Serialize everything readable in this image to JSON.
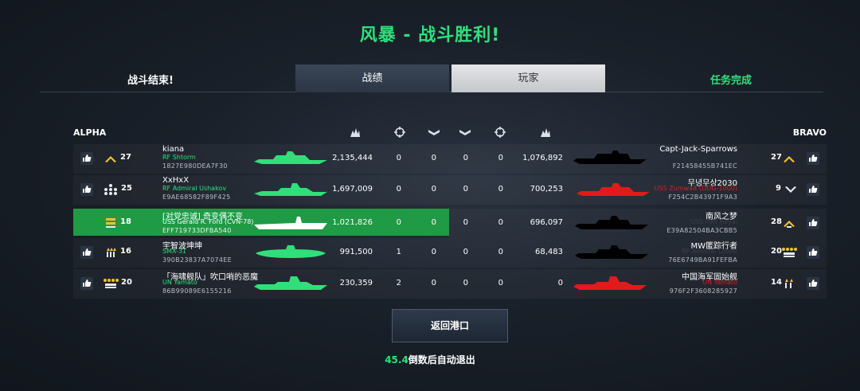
{
  "title": "风暴 - 战斗胜利!",
  "topbar": {
    "left_label": "战斗结束!",
    "tabs": [
      {
        "label": "战绩",
        "active": false
      },
      {
        "label": "玩家",
        "active": true
      }
    ],
    "right_label": "任务完成"
  },
  "teams": {
    "alpha": "ALPHA",
    "bravo": "BRAVO"
  },
  "header_icons": [
    "damage-icon",
    "crosshair-icon",
    "rank-wing-icon",
    "rank-wing-icon",
    "crosshair-icon",
    "damage-icon"
  ],
  "colors": {
    "accent_green": "#2fe07a",
    "enemy_red": "#e01b1b",
    "self_row": "#1f9a45"
  },
  "alpha": [
    {
      "level": "27",
      "name": "kiana",
      "ship": "RF Shtorm",
      "id": "1827E980DEA7F30",
      "damage": "2,135,444",
      "s1": "0",
      "s2": "0",
      "s3": "0",
      "s4": "0"
    },
    {
      "level": "25",
      "name": "XxHxX",
      "ship": "RF Admiral Ushakov",
      "id": "E9AE68582F89F425",
      "damage": "1,697,009",
      "s1": "0",
      "s2": "0",
      "s3": "0",
      "s4": "0"
    },
    {
      "level": "18",
      "name": "[对党忠诚] 奇变偶不变",
      "ship": "USS Gerald R. Ford (CVN-78)",
      "id": "EFF719733DFBA540",
      "damage": "1,021,826",
      "s1": "0",
      "s2": "0",
      "s3": "0",
      "s4": "0"
    },
    {
      "level": "16",
      "name": "宇智波坤坤",
      "ship": "SMX-31",
      "id": "390B23837A7074EE",
      "damage": "991,500",
      "s1": "1",
      "s2": "0",
      "s3": "0",
      "s4": "0"
    },
    {
      "level": "20",
      "name": "「海啸舰队」吹口哨的恶魔",
      "ship": "UN Yamato",
      "id": "86B99089E6155216",
      "damage": "230,359",
      "s1": "2",
      "s2": "0",
      "s3": "0",
      "s4": "0"
    }
  ],
  "bravo": [
    {
      "level": "27",
      "name": "Capt-Jack-Sparrows",
      "ship": "",
      "id": "F21458455B741EC",
      "damage": "1,076,892"
    },
    {
      "level": "9",
      "name": "무녕무상2030",
      "ship": "USS Zumwalt (DDG-1000)",
      "id": "F254C2B43971F9A3",
      "damage": "700,253"
    },
    {
      "level": "28",
      "name": "南风之梦",
      "ship": "USS Port Royal",
      "id": "E39A82504BA3CBB5",
      "damage": "696,097"
    },
    {
      "level": "20",
      "name": "MW匿踪行者",
      "ship": "RF Admiral Lobov",
      "id": "76E6749BA91FEFBA",
      "damage": "68,483"
    },
    {
      "level": "14",
      "name": "中国海军固始舰",
      "ship": "UN Yamato",
      "id": "976F2F3608285927",
      "damage": "0"
    }
  ],
  "return_button": "返回港口",
  "countdown": {
    "seconds": "45.4",
    "text": "倒数后自动退出"
  }
}
